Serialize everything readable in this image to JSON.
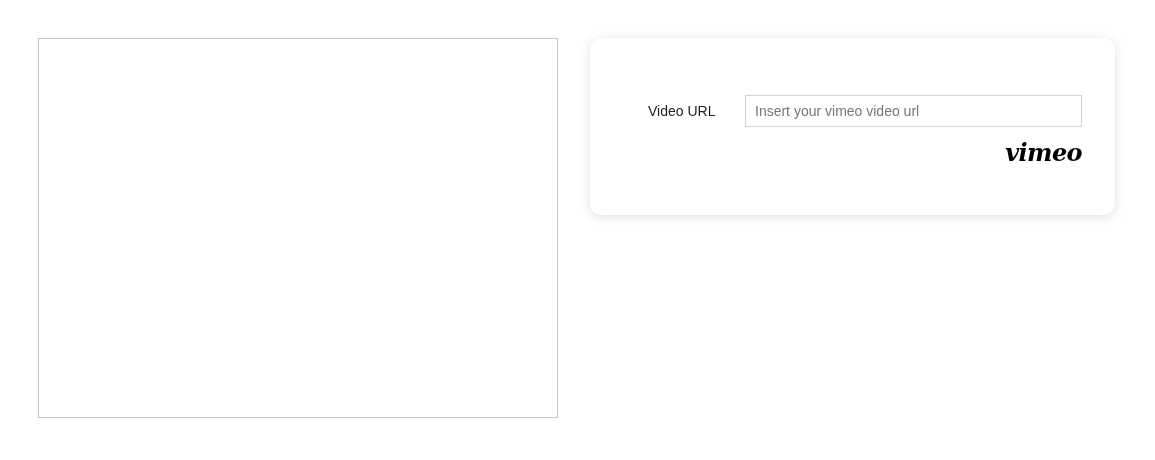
{
  "preview": {
    "kind": "empty"
  },
  "form": {
    "label": "Video URL",
    "field": {
      "placeholder": "Insert your vimeo video url"
    },
    "logo": "vimeo"
  }
}
